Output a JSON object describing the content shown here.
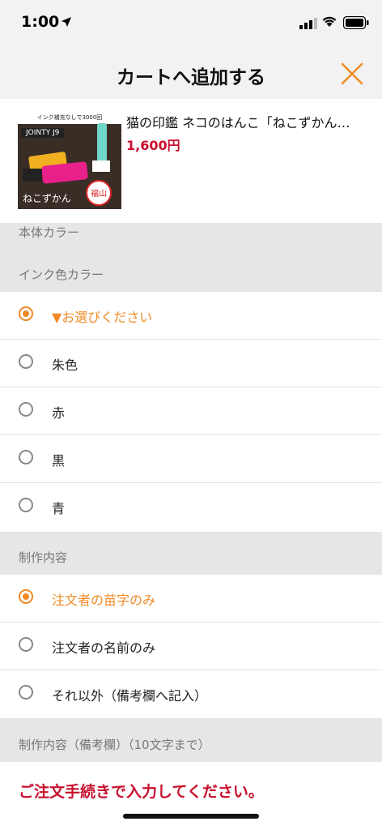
{
  "status_bar": {
    "time": "1:00"
  },
  "nav": {
    "title": "カートへ追加する"
  },
  "product": {
    "name": "猫の印鑑 ネコのはんこ「ねこずかん…",
    "price": "1,600円",
    "thumb_banner": "インク補充なしで3000回",
    "thumb_model": "JOINTY J9",
    "thumb_caption": "ねこずかん"
  },
  "sections": {
    "body_color": "本体カラー",
    "ink_color": "インク色カラー",
    "content": "制作内容",
    "content_note": "制作内容（備考欄）（10文字まで）"
  },
  "ink_options": [
    {
      "label": "▼お選びください",
      "selected": true
    },
    {
      "label": "朱色",
      "selected": false
    },
    {
      "label": "赤",
      "selected": false
    },
    {
      "label": "黒",
      "selected": false
    },
    {
      "label": "青",
      "selected": false
    }
  ],
  "content_options": [
    {
      "label": "注文者の苗字のみ",
      "selected": true
    },
    {
      "label": "注文者の名前のみ",
      "selected": false
    },
    {
      "label": "それ以外（備考欄へ記入）",
      "selected": false
    }
  ],
  "notice": "ご注文手続きで入力してください。",
  "colors": {
    "accent": "#f08a24",
    "price": "#c8102e",
    "section_bg": "#e6e6e6"
  }
}
